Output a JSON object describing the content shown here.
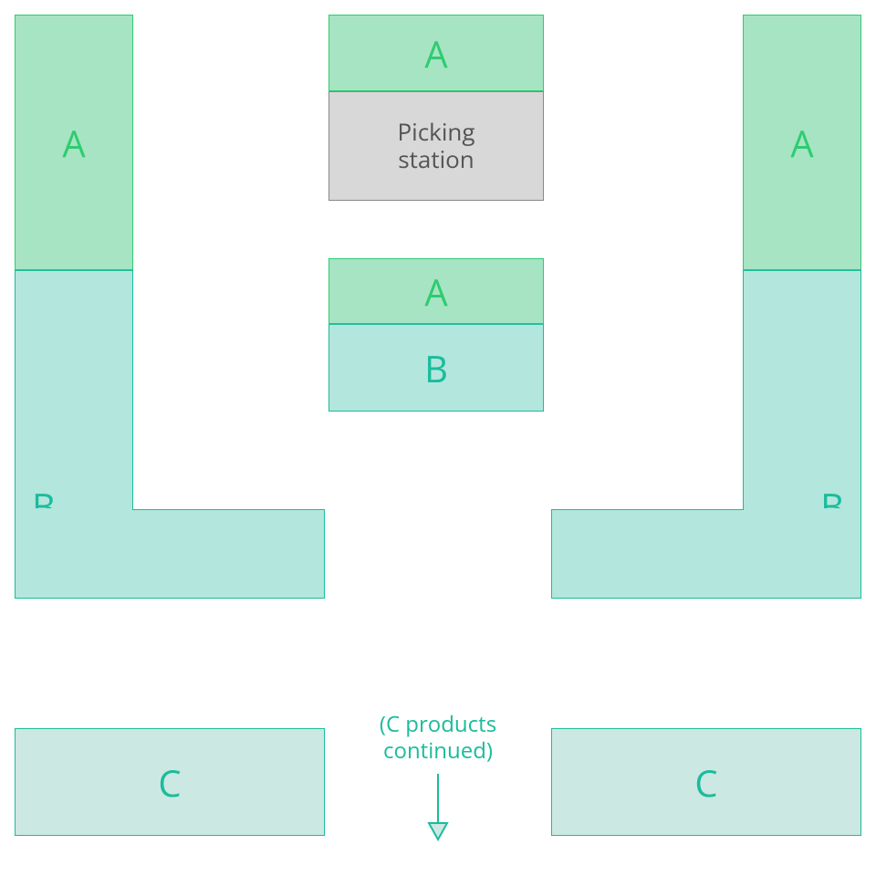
{
  "labels": {
    "A": "A",
    "B": "B",
    "C": "C",
    "picking_station": "Picking\nstation",
    "c_continued": "(C products\ncontinued)"
  },
  "colors": {
    "zone_a_fill": "#a7e4c3",
    "zone_a_stroke": "#2ecc71",
    "zone_b_fill": "#b3e6dd",
    "zone_b_stroke": "#1abc9c",
    "zone_c_fill": "#cce8e2",
    "zone_c_stroke": "#1abc9c",
    "station_fill": "#d8d8d8",
    "station_stroke": "#888888"
  },
  "layout_hint": "ABC slotting diagram: picking station at top centre; A-zones nearest the station (top of side columns, top of central block, above station); B-zones next (lower side columns extended inward into L-shapes, lower half of central block); C-zones at bottom with arrow indicating continuation."
}
